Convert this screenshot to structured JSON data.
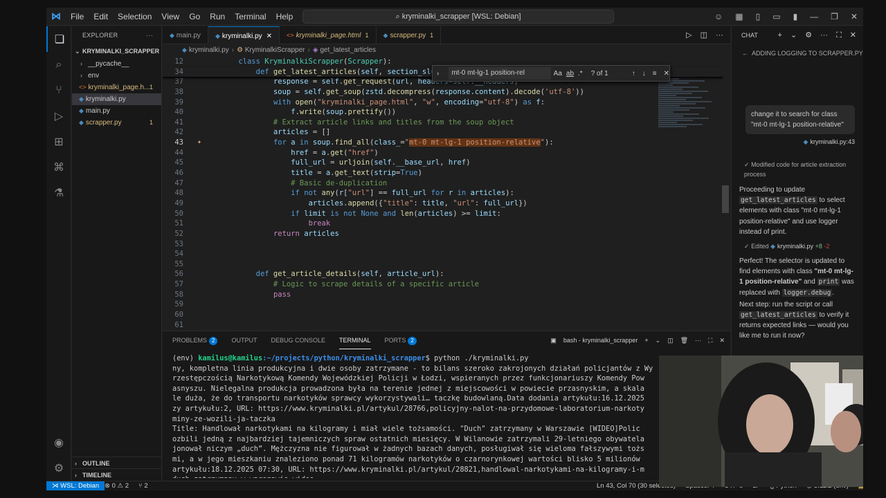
{
  "titlebar": {
    "menu": [
      "File",
      "Edit",
      "Selection",
      "View",
      "Go",
      "Run",
      "Terminal",
      "Help"
    ],
    "command_center": "kryminalki_scrapper [WSL: Debian]"
  },
  "sidebar": {
    "header": "EXPLORER",
    "project": "KRYMINALKI_SCRAPPER [...",
    "items": [
      {
        "label": "__pycache__",
        "type": "folder",
        "badge": ""
      },
      {
        "label": "env",
        "type": "folder",
        "badge": ""
      },
      {
        "label": "kryminalki_page.h...",
        "type": "file",
        "badge": "1"
      },
      {
        "label": "kryminalki.py",
        "type": "file",
        "badge": ""
      },
      {
        "label": "main.py",
        "type": "file",
        "badge": ""
      },
      {
        "label": "scrapper.py",
        "type": "file",
        "badge": "1"
      }
    ],
    "outline": "OUTLINE",
    "timeline": "TIMELINE"
  },
  "tabs": [
    {
      "label": "main.py",
      "badge": ""
    },
    {
      "label": "kryminalki.py",
      "badge": ""
    },
    {
      "label": "kryminalki_page.html",
      "badge": "1"
    },
    {
      "label": "scrapper.py",
      "badge": "1"
    }
  ],
  "breadcrumb": [
    "kryminalki.py",
    "KryminalkiScrapper",
    "get_latest_articles"
  ],
  "find": {
    "query": "mt-0 mt-lg-1 position-rel",
    "opt_case": "Aa",
    "opt_word": "ab",
    "result": "? of 1"
  },
  "code": {
    "lines": [
      {
        "n": "12",
        "t": "    class KryminalkiScrapper(Scrapper):"
      },
      {
        "n": "34",
        "t": "        def get_latest_articles(self, section_slug: str, lim"
      },
      {
        "n": "37",
        "t": "            response = self.get_request(url, headers=self.__headers)"
      },
      {
        "n": "38",
        "t": "            soup = self.get_soup(zstd.decompress(response.content).decode('utf-8'))"
      },
      {
        "n": "39",
        "t": "            with open(\"kryminalki_page.html\", \"w\", encoding=\"utf-8\") as f:"
      },
      {
        "n": "40",
        "t": "                f.write(soup.prettify())"
      },
      {
        "n": "41",
        "t": "            # Extract article links and titles from the soup object"
      },
      {
        "n": "42",
        "t": "            articles = []"
      },
      {
        "n": "43",
        "t": "            for a in soup.find_all(class_=\"mt-0 mt-lg-1 position-relative\"):"
      },
      {
        "n": "44",
        "t": "                href = a.get(\"href\")"
      },
      {
        "n": "45",
        "t": "                full_url = urljoin(self.__base_url, href)"
      },
      {
        "n": "46",
        "t": "                title = a.get_text(strip=True)"
      },
      {
        "n": "47",
        "t": "                # Basic de-duplication"
      },
      {
        "n": "48",
        "t": "                if not any(r[\"url\"] == full_url for r in articles):"
      },
      {
        "n": "49",
        "t": "                    articles.append({\"title\": title, \"url\": full_url})"
      },
      {
        "n": "50",
        "t": "                if limit is not None and len(articles) >= limit:"
      },
      {
        "n": "51",
        "t": "                    break"
      },
      {
        "n": "52",
        "t": "            return articles"
      },
      {
        "n": "53",
        "t": ""
      },
      {
        "n": "54",
        "t": ""
      },
      {
        "n": "55",
        "t": ""
      },
      {
        "n": "56",
        "t": "        def get_article_details(self, article_url):"
      },
      {
        "n": "57",
        "t": "            # Logic to scrape details of a specific article"
      },
      {
        "n": "58",
        "t": "            pass"
      },
      {
        "n": "59",
        "t": ""
      },
      {
        "n": "60",
        "t": ""
      },
      {
        "n": "61",
        "t": ""
      }
    ]
  },
  "panel": {
    "tabs": [
      {
        "label": "PROBLEMS",
        "badge": "2"
      },
      {
        "label": "OUTPUT",
        "badge": ""
      },
      {
        "label": "DEBUG CONSOLE",
        "badge": ""
      },
      {
        "label": "TERMINAL",
        "badge": ""
      },
      {
        "label": "PORTS",
        "badge": "2"
      }
    ],
    "terminal_name": "bash - kryminalki_scrapper",
    "prompt_env": "(env) ",
    "prompt_user": "kamilus@kamilus",
    "prompt_path": ":~/projects/python/kryminalki_scrapper",
    "command": "$ python ./kryminalki.py",
    "output": [
      "ny, kompletna linia produkcyjna i dwie osoby zatrzymane - to bilans szeroko zakrojonych działań policjantów z Wy",
      "rzestępczością Narkotykową Komendy Wojewódzkiej Policji w Łodzi, wspieranych przez funkcjonariuszy Komendy Pow",
      "asnyszu. Nielegalna produkcja prowadzona była na terenie jednej z miejscowości w powiecie przasnyskim, a skala",
      "le duża, że do transportu narkotyków sprawcy wykorzystywali… taczkę budowlaną.Data dodania artykułu:16.12.2025",
      "zy artykułu:2, URL: https://www.kryminalki.pl/artykul/28766,policyjny-nalot-na-przydomowe-laboratorium-narkoty",
      "miny-ze-wozili-ja-taczka",
      "Title: Handlował narkotykami na kilogramy i miał wiele tożsamości. \"Duch\" zatrzymany w Warszawie [WIDEO]Polic",
      "ozbili jedną z najbardziej tajemniczych spraw ostatnich miesięcy. W Wilanowie zatrzymali 29-letniego obywatela",
      "jonował niczym „duch”. Mężczyzna nie figurował w żadnych bazach danych, posługiwał się wieloma fałszywymi tożs",
      "mi, a w jego mieszkaniu znaleziono ponad 71 kilogramów narkotyków o czarnorynkowej wartości blisko 5 milionów",
      "artykułu:18.12.2025 07:30, URL: https://www.kryminalki.pl/artykul/28821,handlowal-narkotykami-na-kilogramy-i-m",
      "duch-zatrzymany-w-warszawie-wideo"
    ],
    "prompt_end": "$ "
  },
  "chat": {
    "header": "CHAT",
    "title": "ADDING LOGGING TO SCRAPPER.PY",
    "user_message": "change it to search for class \"mt-0 mt-lg-1 position-relative\"",
    "file_ref": "kryminalki.py:43",
    "step": "Modified code for article extraction process",
    "p1_a": "Proceeding to update ",
    "p1_code": "get_latest_articles",
    "p1_b": " to select elements with class \"mt-0 mt-lg-1 position-relative\" and use logger instead of print.",
    "edited_label": "Edited",
    "edited_file": "kryminalki.py",
    "edited_add": "+8",
    "edited_del": "-2",
    "p2_a": "Perfect! The selector is updated to find elements with class ",
    "p2_bold": "\"mt-0 mt-lg-1 position-relative\"",
    "p2_b": " and ",
    "p2_code1": "print",
    "p2_c": " was replaced with ",
    "p2_code2": "logger.debug",
    "p2_d": ".",
    "p3_a": "Next step: run the script or call ",
    "p3_code": "get_latest_articles",
    "p3_b": " to verify it returns expected links — would you like me to run it now?"
  },
  "status": {
    "remote": "WSL: Debian",
    "errors": "0",
    "warnings": "2",
    "ports": "2",
    "position": "Ln 43, Col 70 (30 selected)",
    "spaces": "Spaces: 4",
    "encoding": "UTF-8",
    "eol": "LF",
    "language": "Python",
    "interpreter": "3.11.2 (env)"
  }
}
